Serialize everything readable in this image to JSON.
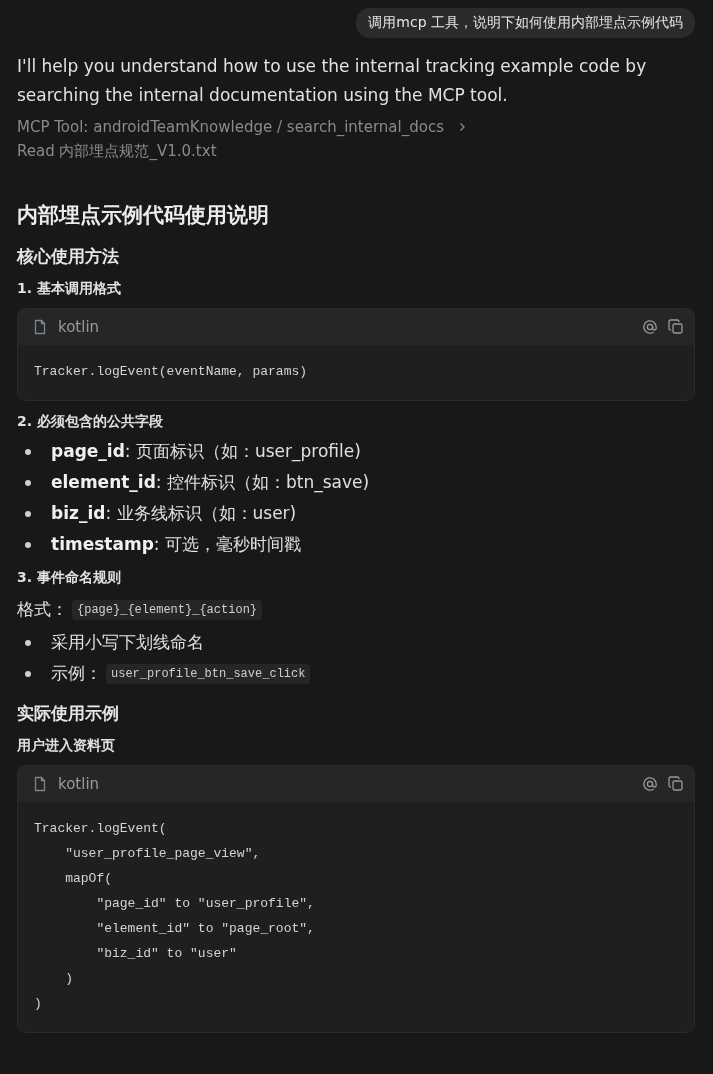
{
  "user_message": "调用mcp 工具，说明下如何使用内部埋点示例代码",
  "reply": {
    "intro": "I'll help you understand how to use the internal tracking example code by searching the internal documentation using the MCP tool.",
    "tool_call": {
      "label": "MCP Tool:",
      "value": "androidTeamKnowledge / search_internal_docs",
      "expanded": false
    },
    "read": {
      "label": "Read",
      "file": "内部埋点规范_V1.0.txt"
    },
    "blocks": [
      {
        "kind": "h1",
        "text": "内部埋点示例代码使用说明"
      },
      {
        "kind": "h2",
        "text": "核心使用方法"
      },
      {
        "kind": "h3",
        "text": "1. 基本调用格式"
      },
      {
        "kind": "code",
        "language": "kotlin",
        "lines": [
          "Tracker.logEvent(eventName, params)"
        ]
      },
      {
        "kind": "h3",
        "text": "2. 必须包含的公共字段"
      },
      {
        "kind": "list",
        "items": [
          {
            "text": "**page_id**: 页面标识（如：user_profile)"
          },
          {
            "text": "**element_id**: 控件标识（如：btn_save)"
          },
          {
            "text": "**biz_id**: 业务线标识（如：user)"
          },
          {
            "text": "**timestamp**: 可选，毫秒时间戳"
          }
        ]
      },
      {
        "kind": "h3",
        "text": "3. 事件命名规则"
      },
      {
        "kind": "para",
        "text": "格式：",
        "code": "{page}_{element}_{action}"
      },
      {
        "kind": "list",
        "items": [
          {
            "text": "采用小写下划线命名"
          },
          {
            "text": "示例：",
            "code": "user_profile_btn_save_click"
          }
        ]
      },
      {
        "kind": "h2",
        "text": "实际使用示例"
      },
      {
        "kind": "h3",
        "text": "用户进入资料页"
      },
      {
        "kind": "code",
        "language": "kotlin",
        "lines": [
          "Tracker.logEvent(",
          "    \"user_profile_page_view\",",
          "    mapOf(",
          "        \"page_id\" to \"user_profile\",",
          "        \"element_id\" to \"page_root\",",
          "        \"biz_id\" to \"user\"",
          "    )",
          ")"
        ]
      }
    ]
  }
}
